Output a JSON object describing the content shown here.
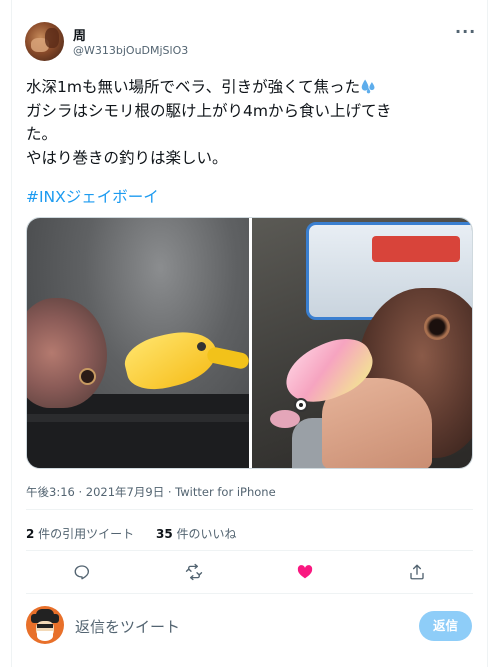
{
  "tweet": {
    "author": {
      "display_name": "周",
      "handle": "@W313bjOuDMjSlO3",
      "avatar_icon": "profile-avatar"
    },
    "more_glyph": "···",
    "text_lines": [
      "水深1mも無い場所でベラ、引きが強くて焦った",
      "ガシラはシモリ根の駆け上がり4mから食い上げてき",
      "た。",
      "やはり巻きの釣りは楽しい。"
    ],
    "emoji": "sweat-droplets-emoji",
    "hashtag": "#INXジェイボーイ",
    "timestamp": "午後3:16 · 2021年7月9日 · Twitter for iPhone"
  },
  "stats": {
    "quote_count": "2",
    "quote_label": " 件の引用ツイート",
    "like_count": "35",
    "like_label": " 件のいいね"
  },
  "actions": [
    {
      "name": "reply",
      "icon": "reply-icon"
    },
    {
      "name": "retweet",
      "icon": "retweet-icon"
    },
    {
      "name": "like",
      "icon": "heart-icon",
      "active_color": "#f91880"
    },
    {
      "name": "share",
      "icon": "share-icon"
    }
  ],
  "composer": {
    "placeholder": "返信をツイート",
    "button_label": "返信"
  },
  "colors": {
    "accent": "#1d9bf0",
    "muted_text": "#536471",
    "like_red": "#f91880",
    "button_disabled": "#8ecdf8"
  }
}
